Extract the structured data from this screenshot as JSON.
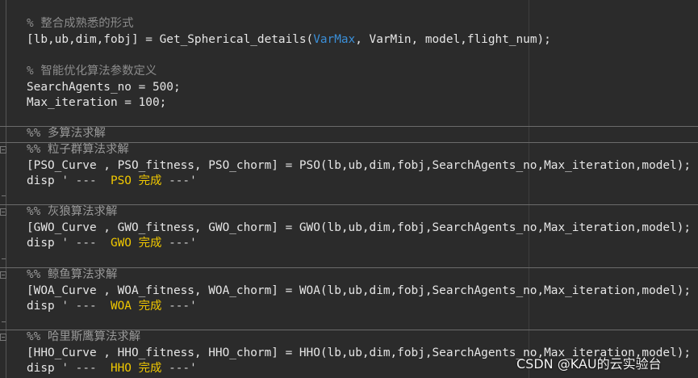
{
  "code": {
    "comment_integrate": "% 整合成熟悉的形式",
    "line_details_pre": "[lb,ub,dim,fobj] = Get_Spherical_details(",
    "line_details_var": "VarMax",
    "line_details_post": ", VarMin, model,flight_num);",
    "comment_params": "% 智能优化算法参数定义",
    "line_search_agents": "SearchAgents_no = 500;",
    "line_max_iter": "Max_iteration = 100;",
    "section_multi": "%% 多算法求解",
    "sections": [
      {
        "title": "%% 粒子群算法求解",
        "call": "[PSO_Curve , PSO_fitness, PSO_chorm] = PSO(lb,ub,dim,fobj,SearchAgents_no,Max_iteration,model);",
        "disp_pre": "disp ",
        "disp_str_open": "' ---  ",
        "disp_kw": "PSO 完成",
        "disp_str_close": " ---'"
      },
      {
        "title": "%% 灰狼算法求解",
        "call": "[GWO_Curve , GWO_fitness, GWO_chorm] = GWO(lb,ub,dim,fobj,SearchAgents_no,Max_iteration,model);",
        "disp_pre": "disp ",
        "disp_str_open": "' ---  ",
        "disp_kw": "GWO 完成",
        "disp_str_close": " ---'"
      },
      {
        "title": "%% 鲸鱼算法求解",
        "call": "[WOA_Curve , WOA_fitness, WOA_chorm] = WOA(lb,ub,dim,fobj,SearchAgents_no,Max_iteration,model);",
        "disp_pre": "disp ",
        "disp_str_open": "' ---  ",
        "disp_kw": "WOA 完成",
        "disp_str_close": " ---'"
      },
      {
        "title": "%% 哈里斯鹰算法求解",
        "call": "[HHO_Curve , HHO_fitness, HHO_chorm] = HHO(lb,ub,dim,fobj,SearchAgents_no,Max_iteration,model);",
        "disp_pre": "disp ",
        "disp_str_open": "' ---  ",
        "disp_kw": "HHO 完成",
        "disp_str_close": " ---'"
      }
    ]
  },
  "watermark": "CSDN @KAU的云实验台",
  "colors": {
    "background": "#2b2b2b",
    "comment": "#8c8c8c",
    "string_keyword": "#f0c800",
    "variable_highlight": "#3b8fd8"
  }
}
